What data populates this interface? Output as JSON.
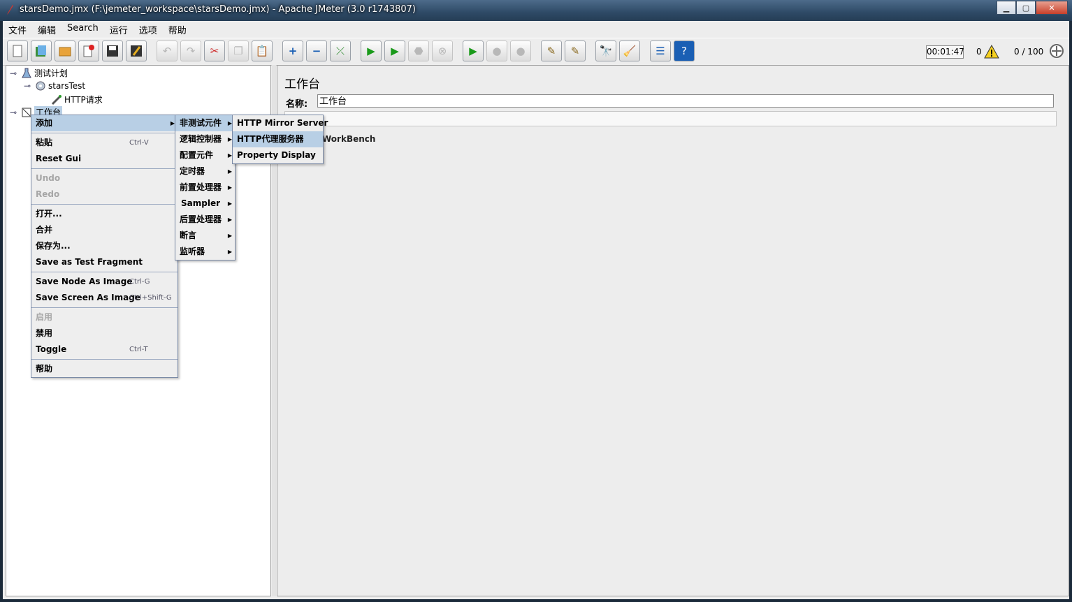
{
  "window": {
    "title": "starsDemo.jmx (F:\\jemeter_workspace\\starsDemo.jmx) - Apache JMeter (3.0 r1743807)"
  },
  "menubar": [
    "文件",
    "编辑",
    "Search",
    "运行",
    "选项",
    "帮助"
  ],
  "toolbar": {
    "icons": [
      "new-icon",
      "templates-icon",
      "open-icon",
      "close-file-icon",
      "save-icon",
      "save-as-icon",
      "undo-icon",
      "redo-icon",
      "cut-icon",
      "copy-icon",
      "paste-icon",
      "expand-all-icon",
      "collapse-all-icon",
      "toggle-icon",
      "start-icon",
      "start-no-pause-icon",
      "stop-icon",
      "shutdown-icon",
      "remote-start-icon",
      "remote-stop-icon",
      "remote-shutdown-icon",
      "clear-icon",
      "clear-all-icon",
      "search-icon",
      "reset-search-icon",
      "function-helper-icon",
      "help-icon"
    ],
    "elapsed": "00:01:47",
    "error_count": "0",
    "threads": "0 / 100"
  },
  "tree": {
    "test_plan": "测试计划",
    "thread_group": "starsTest",
    "http_request": "HTTP请求",
    "workbench": "工作台"
  },
  "panel": {
    "title": "工作台",
    "name_label": "名称:",
    "name_value": "工作台",
    "workbench_text": "WorkBench"
  },
  "context_menu": {
    "add": "添加",
    "paste": "粘贴",
    "paste_shortcut": "Ctrl-V",
    "reset_gui": "Reset Gui",
    "undo": "Undo",
    "redo": "Redo",
    "open": "打开...",
    "merge": "合并",
    "save_as": "保存为...",
    "save_fragment": "Save as Test Fragment",
    "save_node_image": "Save Node As Image",
    "save_node_shortcut": "Ctrl-G",
    "save_screen_image": "Save Screen As Image",
    "save_screen_shortcut": "Ctrl+Shift-G",
    "enable": "启用",
    "disable": "禁用",
    "toggle": "Toggle",
    "toggle_shortcut": "Ctrl-T",
    "help": "帮助"
  },
  "submenu_add": [
    "非测试元件",
    "逻辑控制器",
    "配置元件",
    "定时器",
    "前置处理器",
    "Sampler",
    "后置处理器",
    "断言",
    "监听器"
  ],
  "submenu_non_test": [
    "HTTP Mirror Server",
    "HTTP代理服务器",
    "Property Display"
  ]
}
